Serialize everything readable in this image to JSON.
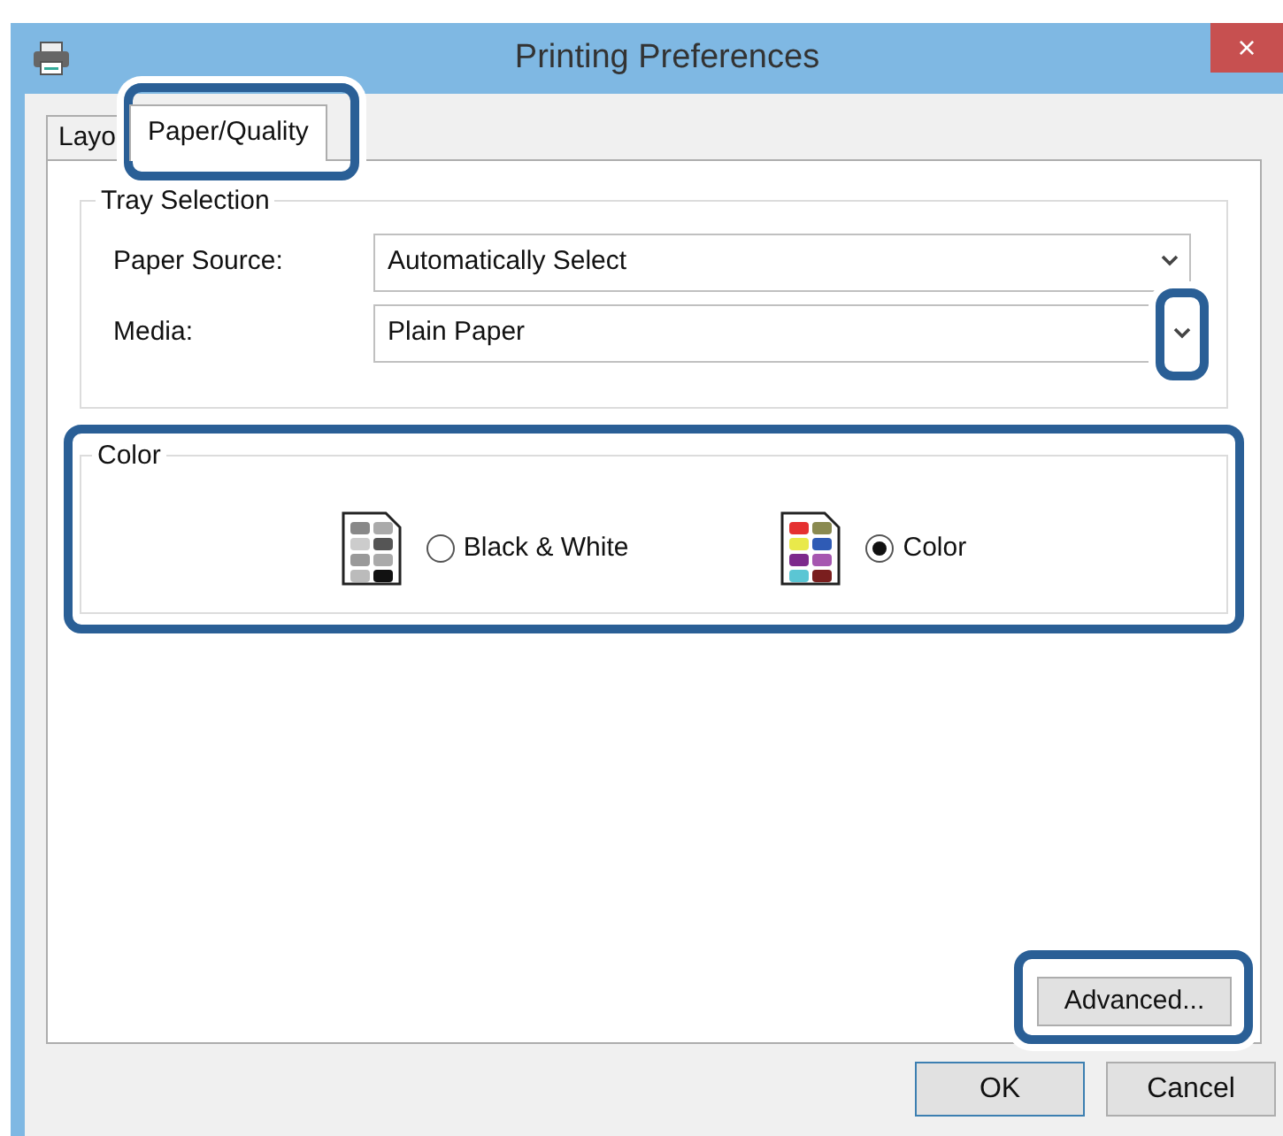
{
  "window": {
    "title": "Printing Preferences",
    "close": "×"
  },
  "tabs": [
    {
      "label": "Layo",
      "selected": false,
      "highlighted": false
    },
    {
      "label": "Paper/Quality",
      "selected": true,
      "highlighted": true
    }
  ],
  "tray_selection": {
    "title": "Tray Selection",
    "fields": [
      {
        "label": "Paper Source:",
        "value": "Automatically Select",
        "highlighted": false
      },
      {
        "label": "Media:",
        "value": "Plain Paper",
        "highlighted": true
      }
    ]
  },
  "color": {
    "title": "Color",
    "highlighted": true,
    "options": [
      {
        "label": "Black & White",
        "kind": "mono",
        "selected": false
      },
      {
        "label": "Color",
        "kind": "color",
        "selected": true
      }
    ]
  },
  "advanced_button": {
    "label": "Advanced...",
    "highlighted": true
  },
  "buttons": [
    {
      "label": "OK",
      "default": true
    },
    {
      "label": "Cancel",
      "default": false
    }
  ]
}
